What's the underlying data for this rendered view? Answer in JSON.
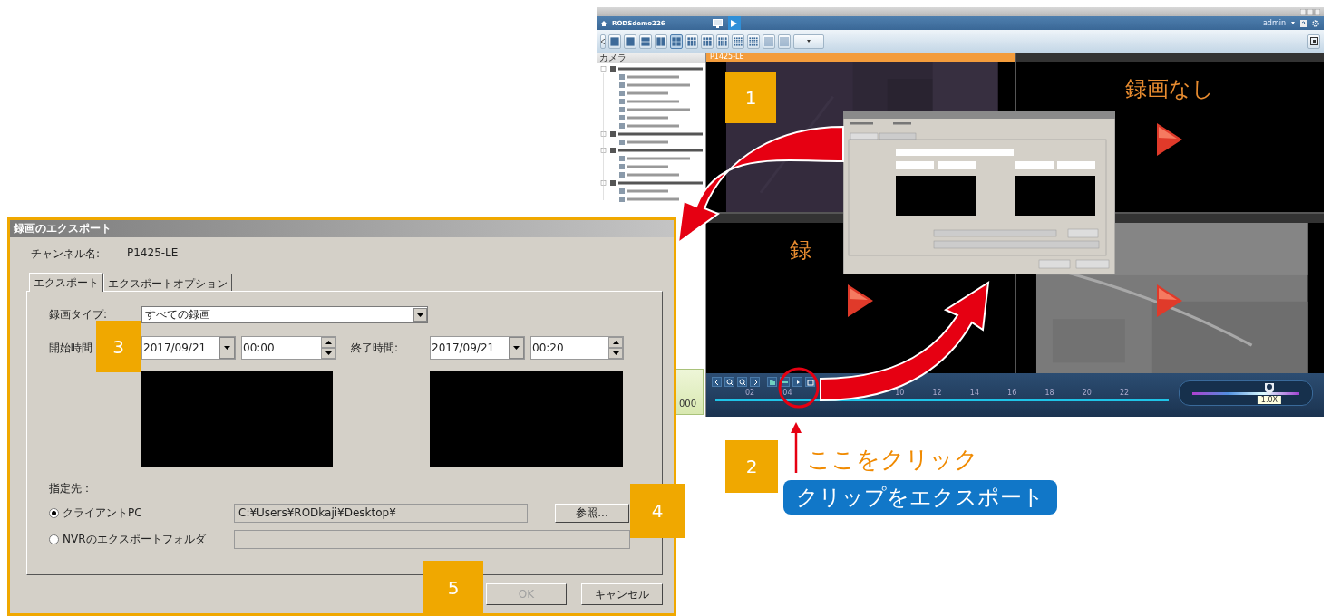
{
  "nvr_window": {
    "server": "RODSdemo226",
    "user": "admin",
    "panel_title": "カメラ",
    "tiles": [
      {
        "kind": "video",
        "title": "P1425-LE",
        "selected": true
      },
      {
        "kind": "empty",
        "message": "録画なし",
        "selected": false
      },
      {
        "kind": "empty",
        "message": "録",
        "selected": false
      },
      {
        "kind": "video",
        "selected": false
      }
    ],
    "readout": "000",
    "timeline": {
      "ticks": [
        "02",
        "04",
        "10",
        "12",
        "14",
        "16",
        "18",
        "20",
        "22"
      ],
      "speed": "1.0X",
      "level": 0.72
    }
  },
  "export_dialog": {
    "title": "録画のエクスポート",
    "channel_label": "チャンネル名:",
    "channel": "P1425-LE",
    "tabs": [
      {
        "label": "エクスポート",
        "selected": true
      },
      {
        "label": "エクスポートオプション",
        "selected": false
      }
    ],
    "record_type_label": "録画タイプ:",
    "record_type": "すべての録画",
    "start_label": "開始時間",
    "start_date": "2017/09/21",
    "start_time": "00:00",
    "end_label": "終了時間:",
    "end_date": "2017/09/21",
    "end_time": "00:20",
    "destination_label": "指定先：",
    "destinations": [
      {
        "label": "クライアントPC",
        "selected": true,
        "path": "C:¥Users¥RODkaji¥Desktop¥"
      },
      {
        "label": "NVRのエクスポートフォルダ",
        "selected": false
      }
    ],
    "browse": "参照...",
    "ok": {
      "label": "OK",
      "disabled": true
    },
    "cancel": "キャンセル"
  },
  "steps": [
    "1",
    "2",
    "3",
    "4",
    "5"
  ],
  "callout": {
    "instruction": "ここをクリック",
    "button": "クリップをエクスポート"
  }
}
